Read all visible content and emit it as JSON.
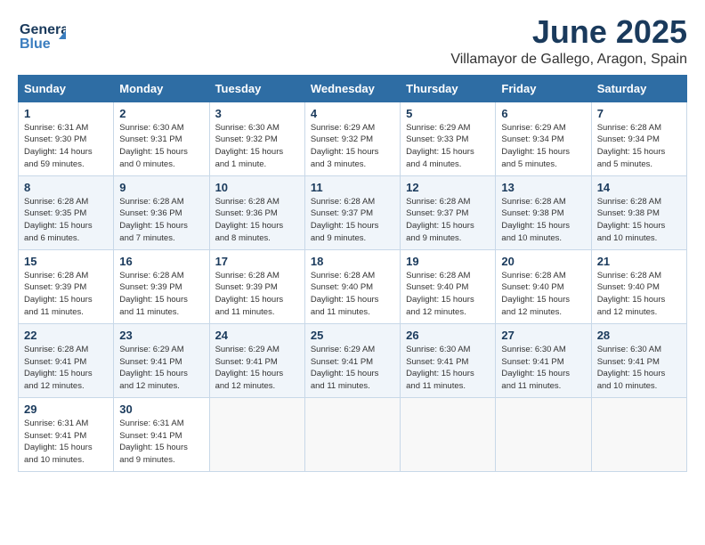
{
  "logo": {
    "line1": "General",
    "line2": "Blue"
  },
  "title": "June 2025",
  "location": "Villamayor de Gallego, Aragon, Spain",
  "days_of_week": [
    "Sunday",
    "Monday",
    "Tuesday",
    "Wednesday",
    "Thursday",
    "Friday",
    "Saturday"
  ],
  "weeks": [
    [
      {
        "day": "1",
        "info": "Sunrise: 6:31 AM\nSunset: 9:30 PM\nDaylight: 14 hours\nand 59 minutes."
      },
      {
        "day": "2",
        "info": "Sunrise: 6:30 AM\nSunset: 9:31 PM\nDaylight: 15 hours\nand 0 minutes."
      },
      {
        "day": "3",
        "info": "Sunrise: 6:30 AM\nSunset: 9:32 PM\nDaylight: 15 hours\nand 1 minute."
      },
      {
        "day": "4",
        "info": "Sunrise: 6:29 AM\nSunset: 9:32 PM\nDaylight: 15 hours\nand 3 minutes."
      },
      {
        "day": "5",
        "info": "Sunrise: 6:29 AM\nSunset: 9:33 PM\nDaylight: 15 hours\nand 4 minutes."
      },
      {
        "day": "6",
        "info": "Sunrise: 6:29 AM\nSunset: 9:34 PM\nDaylight: 15 hours\nand 5 minutes."
      },
      {
        "day": "7",
        "info": "Sunrise: 6:28 AM\nSunset: 9:34 PM\nDaylight: 15 hours\nand 5 minutes."
      }
    ],
    [
      {
        "day": "8",
        "info": "Sunrise: 6:28 AM\nSunset: 9:35 PM\nDaylight: 15 hours\nand 6 minutes."
      },
      {
        "day": "9",
        "info": "Sunrise: 6:28 AM\nSunset: 9:36 PM\nDaylight: 15 hours\nand 7 minutes."
      },
      {
        "day": "10",
        "info": "Sunrise: 6:28 AM\nSunset: 9:36 PM\nDaylight: 15 hours\nand 8 minutes."
      },
      {
        "day": "11",
        "info": "Sunrise: 6:28 AM\nSunset: 9:37 PM\nDaylight: 15 hours\nand 9 minutes."
      },
      {
        "day": "12",
        "info": "Sunrise: 6:28 AM\nSunset: 9:37 PM\nDaylight: 15 hours\nand 9 minutes."
      },
      {
        "day": "13",
        "info": "Sunrise: 6:28 AM\nSunset: 9:38 PM\nDaylight: 15 hours\nand 10 minutes."
      },
      {
        "day": "14",
        "info": "Sunrise: 6:28 AM\nSunset: 9:38 PM\nDaylight: 15 hours\nand 10 minutes."
      }
    ],
    [
      {
        "day": "15",
        "info": "Sunrise: 6:28 AM\nSunset: 9:39 PM\nDaylight: 15 hours\nand 11 minutes."
      },
      {
        "day": "16",
        "info": "Sunrise: 6:28 AM\nSunset: 9:39 PM\nDaylight: 15 hours\nand 11 minutes."
      },
      {
        "day": "17",
        "info": "Sunrise: 6:28 AM\nSunset: 9:39 PM\nDaylight: 15 hours\nand 11 minutes."
      },
      {
        "day": "18",
        "info": "Sunrise: 6:28 AM\nSunset: 9:40 PM\nDaylight: 15 hours\nand 11 minutes."
      },
      {
        "day": "19",
        "info": "Sunrise: 6:28 AM\nSunset: 9:40 PM\nDaylight: 15 hours\nand 12 minutes."
      },
      {
        "day": "20",
        "info": "Sunrise: 6:28 AM\nSunset: 9:40 PM\nDaylight: 15 hours\nand 12 minutes."
      },
      {
        "day": "21",
        "info": "Sunrise: 6:28 AM\nSunset: 9:40 PM\nDaylight: 15 hours\nand 12 minutes."
      }
    ],
    [
      {
        "day": "22",
        "info": "Sunrise: 6:28 AM\nSunset: 9:41 PM\nDaylight: 15 hours\nand 12 minutes."
      },
      {
        "day": "23",
        "info": "Sunrise: 6:29 AM\nSunset: 9:41 PM\nDaylight: 15 hours\nand 12 minutes."
      },
      {
        "day": "24",
        "info": "Sunrise: 6:29 AM\nSunset: 9:41 PM\nDaylight: 15 hours\nand 12 minutes."
      },
      {
        "day": "25",
        "info": "Sunrise: 6:29 AM\nSunset: 9:41 PM\nDaylight: 15 hours\nand 11 minutes."
      },
      {
        "day": "26",
        "info": "Sunrise: 6:30 AM\nSunset: 9:41 PM\nDaylight: 15 hours\nand 11 minutes."
      },
      {
        "day": "27",
        "info": "Sunrise: 6:30 AM\nSunset: 9:41 PM\nDaylight: 15 hours\nand 11 minutes."
      },
      {
        "day": "28",
        "info": "Sunrise: 6:30 AM\nSunset: 9:41 PM\nDaylight: 15 hours\nand 10 minutes."
      }
    ],
    [
      {
        "day": "29",
        "info": "Sunrise: 6:31 AM\nSunset: 9:41 PM\nDaylight: 15 hours\nand 10 minutes."
      },
      {
        "day": "30",
        "info": "Sunrise: 6:31 AM\nSunset: 9:41 PM\nDaylight: 15 hours\nand 9 minutes."
      },
      {
        "day": "",
        "info": ""
      },
      {
        "day": "",
        "info": ""
      },
      {
        "day": "",
        "info": ""
      },
      {
        "day": "",
        "info": ""
      },
      {
        "day": "",
        "info": ""
      }
    ]
  ]
}
